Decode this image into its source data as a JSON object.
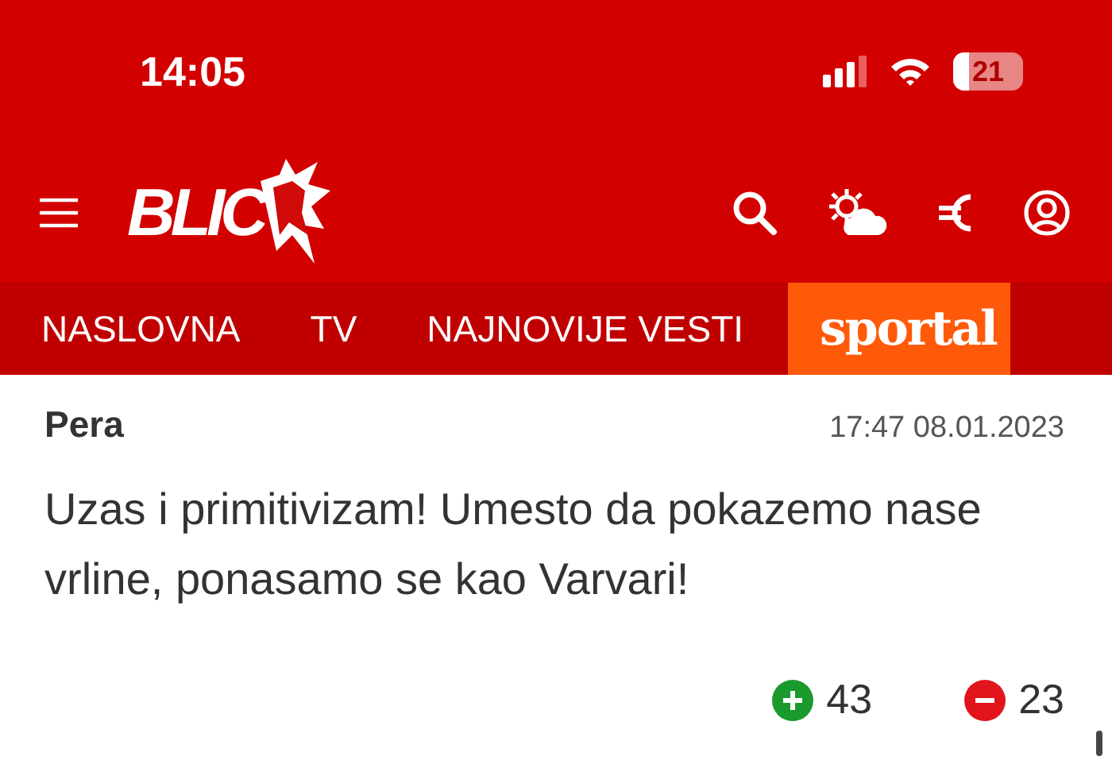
{
  "status_bar": {
    "time": "14:05",
    "battery": "21"
  },
  "header": {
    "logo": "BLIC"
  },
  "nav": [
    {
      "label": "NASLOVNA",
      "kind": "link"
    },
    {
      "label": "TV",
      "kind": "link"
    },
    {
      "label": "NAJNOVIJE VESTI",
      "kind": "link"
    },
    {
      "label": "sportal",
      "kind": "brand"
    }
  ],
  "comment": {
    "author": "Pera",
    "time": "17:47 08.01.2023",
    "text": "Uzas i primitivizam! Umesto da pokazemo nase vrline, ponasamo se kao Varvari!",
    "likes": "43",
    "dislikes": "23"
  }
}
